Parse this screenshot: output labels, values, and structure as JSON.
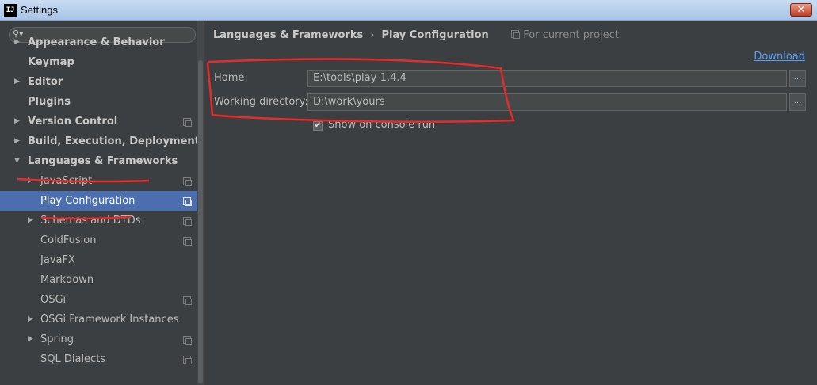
{
  "window": {
    "title": "Settings",
    "app_icon_text": "IJ"
  },
  "sidebar": {
    "search": {
      "value": "",
      "placeholder": ""
    },
    "items": [
      {
        "label": "Appearance & Behavior",
        "bold": true,
        "arrow": "collapsed",
        "project": false,
        "level": 0
      },
      {
        "label": "Keymap",
        "bold": true,
        "arrow": "none",
        "project": false,
        "level": 0
      },
      {
        "label": "Editor",
        "bold": true,
        "arrow": "collapsed",
        "project": false,
        "level": 0
      },
      {
        "label": "Plugins",
        "bold": true,
        "arrow": "none",
        "project": false,
        "level": 0
      },
      {
        "label": "Version Control",
        "bold": true,
        "arrow": "collapsed",
        "project": true,
        "level": 0
      },
      {
        "label": "Build, Execution, Deployment",
        "bold": true,
        "arrow": "collapsed",
        "project": false,
        "level": 0
      },
      {
        "label": "Languages & Frameworks",
        "bold": true,
        "arrow": "expanded",
        "project": false,
        "level": 0
      },
      {
        "label": "JavaScript",
        "bold": false,
        "arrow": "collapsed",
        "project": true,
        "level": 1
      },
      {
        "label": "Play Configuration",
        "bold": false,
        "arrow": "none",
        "project": true,
        "level": 1,
        "selected": true
      },
      {
        "label": "Schemas and DTDs",
        "bold": false,
        "arrow": "collapsed",
        "project": true,
        "level": 1
      },
      {
        "label": "ColdFusion",
        "bold": false,
        "arrow": "none",
        "project": true,
        "level": 1
      },
      {
        "label": "JavaFX",
        "bold": false,
        "arrow": "none",
        "project": false,
        "level": 1
      },
      {
        "label": "Markdown",
        "bold": false,
        "arrow": "none",
        "project": false,
        "level": 1
      },
      {
        "label": "OSGi",
        "bold": false,
        "arrow": "none",
        "project": true,
        "level": 1
      },
      {
        "label": "OSGi Framework Instances",
        "bold": false,
        "arrow": "collapsed",
        "project": false,
        "level": 1
      },
      {
        "label": "Spring",
        "bold": false,
        "arrow": "collapsed",
        "project": true,
        "level": 1
      },
      {
        "label": "SQL Dialects",
        "bold": false,
        "arrow": "none",
        "project": true,
        "level": 1
      }
    ]
  },
  "breadcrumb": {
    "parent": "Languages & Frameworks",
    "separator": "›",
    "current": "Play Configuration",
    "scope": "For current project"
  },
  "download_link": "Download",
  "form": {
    "home_label": "Home:",
    "home_value": "E:\\tools\\play-1.4.4",
    "workdir_label": "Working directory:",
    "workdir_value": "D:\\work\\yours",
    "browse_label": "...",
    "show_console_label": "Show on console run",
    "show_console_checked": true
  },
  "colors": {
    "selection": "#4b6eaf",
    "link": "#589df6",
    "annotation": "#e52b2b",
    "background": "#3c3f41"
  },
  "icons": {
    "search": "search-icon",
    "project_scope": "project-scope-icon",
    "close": "close-icon"
  }
}
